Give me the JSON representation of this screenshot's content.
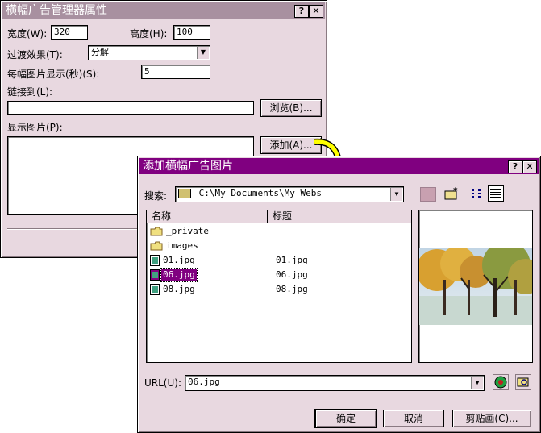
{
  "dialog1": {
    "title": "横幅广告管理器属性",
    "width_label": "宽度(W):",
    "width_value": "320",
    "height_label": "高度(H):",
    "height_value": "100",
    "transition_label": "过渡效果(T):",
    "transition_value": "分解",
    "seconds_label": "每幅图片显示(秒)(S):",
    "seconds_value": "5",
    "link_label": "链接到(L):",
    "link_value": "",
    "browse_label": "浏览(B)...",
    "images_label": "显示图片(P):",
    "add_label": "添加(A)..."
  },
  "dialog2": {
    "title": "添加横幅广告图片",
    "search_label": "搜索:",
    "path_value": "C:\\My Documents\\My Webs",
    "columns": [
      "名称",
      "标题"
    ],
    "files": [
      {
        "name": "_private",
        "title": "",
        "type": "folder"
      },
      {
        "name": "images",
        "title": "",
        "type": "folder"
      },
      {
        "name": "01.jpg",
        "title": "01.jpg",
        "type": "image"
      },
      {
        "name": "06.jpg",
        "title": "06.jpg",
        "type": "image",
        "selected": true
      },
      {
        "name": "08.jpg",
        "title": "08.jpg",
        "type": "image"
      }
    ],
    "url_label": "URL(U):",
    "url_value": "06.jpg",
    "ok_label": "确定",
    "cancel_label": "取消",
    "clipart_label": "剪贴画(C)..."
  },
  "colors": {
    "titlebar_active": "#800080",
    "dialog_bg": "#e8d8e0",
    "arrow": "#ffff00"
  }
}
